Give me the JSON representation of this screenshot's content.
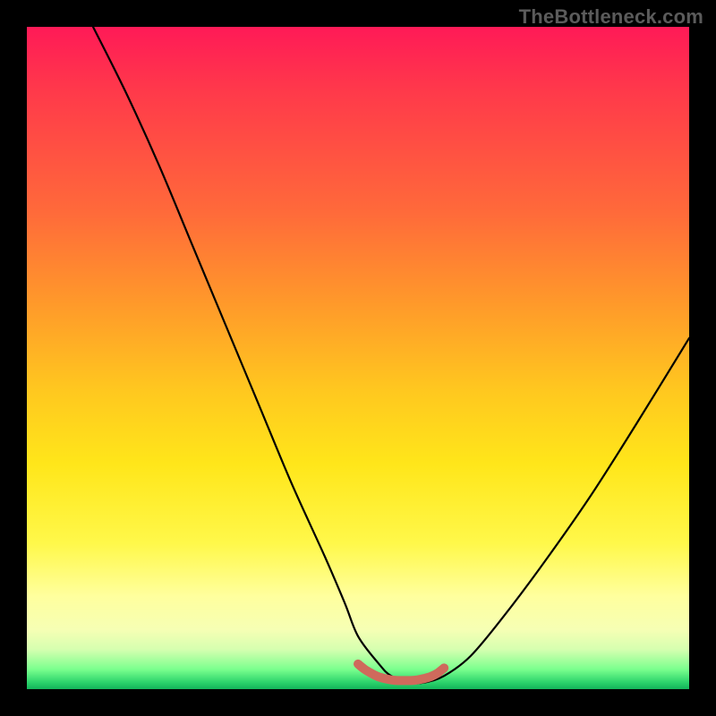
{
  "watermark": "TheBottleneck.com",
  "chart_data": {
    "type": "line",
    "title": "",
    "xlabel": "",
    "ylabel": "",
    "xlim": [
      0,
      100
    ],
    "ylim": [
      0,
      100
    ],
    "grid": false,
    "legend": false,
    "series": [
      {
        "name": "bottleneck-curve",
        "color": "#000000",
        "x": [
          10,
          15,
          20,
          25,
          30,
          35,
          40,
          45,
          48,
          50,
          53,
          55,
          58,
          60,
          63,
          67,
          72,
          78,
          85,
          92,
          100
        ],
        "y": [
          100,
          90,
          79,
          67,
          55,
          43,
          31,
          20,
          13,
          8,
          4,
          2,
          1,
          1,
          2,
          5,
          11,
          19,
          29,
          40,
          53
        ]
      },
      {
        "name": "valley-marker",
        "color": "#d06a5a",
        "x": [
          50,
          51,
          52,
          53,
          54,
          55,
          56,
          57,
          58,
          59,
          60,
          61,
          62,
          63
        ],
        "y": [
          3.8,
          3.0,
          2.4,
          1.9,
          1.6,
          1.4,
          1.3,
          1.3,
          1.3,
          1.4,
          1.6,
          1.9,
          2.4,
          3.2
        ]
      }
    ],
    "gradient_stops": [
      {
        "pos": 0,
        "color": "#ff1a57"
      },
      {
        "pos": 10,
        "color": "#ff3a4a"
      },
      {
        "pos": 28,
        "color": "#ff6a3a"
      },
      {
        "pos": 42,
        "color": "#ff9a2a"
      },
      {
        "pos": 55,
        "color": "#ffc81f"
      },
      {
        "pos": 66,
        "color": "#ffe61a"
      },
      {
        "pos": 78,
        "color": "#fff84a"
      },
      {
        "pos": 86,
        "color": "#ffff9e"
      },
      {
        "pos": 91,
        "color": "#f6ffb4"
      },
      {
        "pos": 94,
        "color": "#d6ffb0"
      },
      {
        "pos": 97,
        "color": "#7bff8e"
      },
      {
        "pos": 99,
        "color": "#2bd36b"
      },
      {
        "pos": 100,
        "color": "#13b45a"
      }
    ]
  }
}
